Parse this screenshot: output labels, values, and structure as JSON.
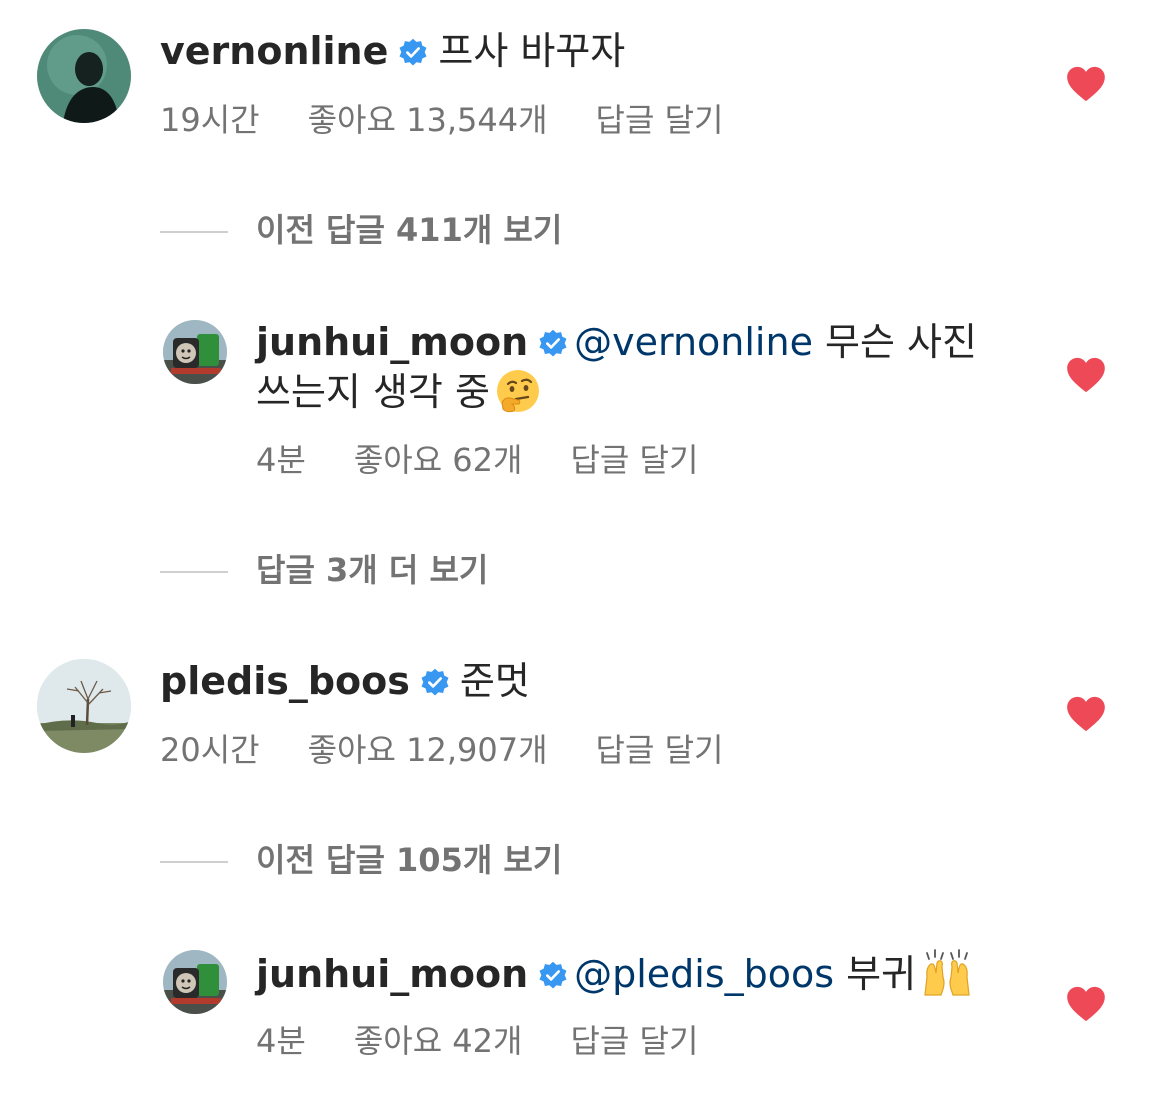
{
  "comments": [
    {
      "username": "vernonline",
      "text": "프사 바꾸자",
      "time": "19시간",
      "likes": "좋아요 13,544개",
      "reply": "답글 달기"
    },
    {
      "username": "junhui_moon",
      "mention": "@vernonline",
      "text_line1": "무슨 사진",
      "text_line2": "쓰는지 생각 중",
      "emoji": "thinking-face",
      "time": "4분",
      "likes": "좋아요 62개",
      "reply": "답글 달기"
    },
    {
      "username": "pledis_boos",
      "text": "준멋",
      "time": "20시간",
      "likes": "좋아요 12,907개",
      "reply": "답글 달기"
    },
    {
      "username": "junhui_moon",
      "mention": "@pledis_boos",
      "text": "부귀",
      "emoji": "raising-hands",
      "time": "4분",
      "likes": "좋아요 42개",
      "reply": "답글 달기"
    }
  ],
  "threads": [
    "이전 답글 411개 보기",
    "답글 3개 더 보기",
    "이전 답글 105개 보기"
  ],
  "colors": {
    "heart": "#ed4956",
    "verified": "#3897f0",
    "mention": "#00376b",
    "secondary_text": "#737373"
  }
}
